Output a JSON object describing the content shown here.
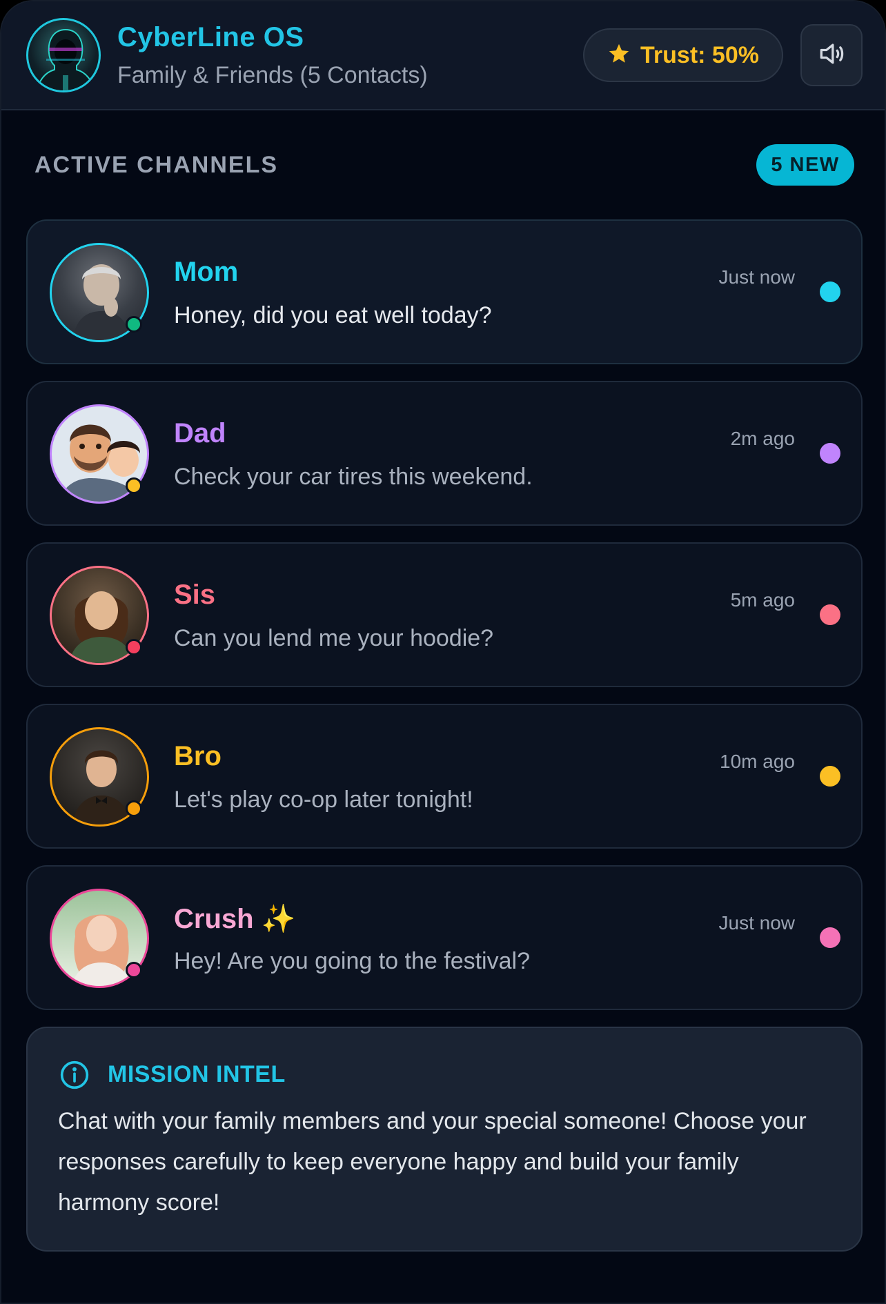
{
  "header": {
    "title": "CyberLine OS",
    "subtitle": "Family & Friends (5 Contacts)",
    "trust_label": "Trust: 50%",
    "trust_icon": "star-icon",
    "sound_icon": "speaker-icon"
  },
  "channels": {
    "title": "ACTIVE CHANNELS",
    "badge": "5 NEW"
  },
  "contacts": [
    {
      "name": "Mom",
      "message": "Honey, did you eat well today?",
      "time": "Just now",
      "color": "#22d3ee",
      "status_color": "#10b981",
      "unread": true
    },
    {
      "name": "Dad",
      "message": "Check your car tires this weekend.",
      "time": "2m ago",
      "color": "#c084fc",
      "status_color": "#fbbf24",
      "unread": true
    },
    {
      "name": "Sis",
      "message": "Can you lend me your hoodie?",
      "time": "5m ago",
      "color": "#fb7185",
      "status_color": "#f43f5e",
      "unread": true
    },
    {
      "name": "Bro",
      "message": "Let's play co-op later tonight!",
      "time": "10m ago",
      "color": "#fbbf24",
      "status_color": "#f59e0b",
      "unread": true
    },
    {
      "name": "Crush ✨",
      "message": "Hey! Are you going to the festival?",
      "time": "Just now",
      "color": "#f472b6",
      "status_color": "#ec4899",
      "unread": true
    }
  ],
  "intel": {
    "title": "MISSION INTEL",
    "icon": "info-icon",
    "body": "Chat with your family members and your special someone! Choose your responses carefully to keep everyone happy and build your family harmony score!"
  },
  "colors": {
    "accent": "#22c5e6",
    "trust": "#fbbf24",
    "background": "#030814"
  }
}
